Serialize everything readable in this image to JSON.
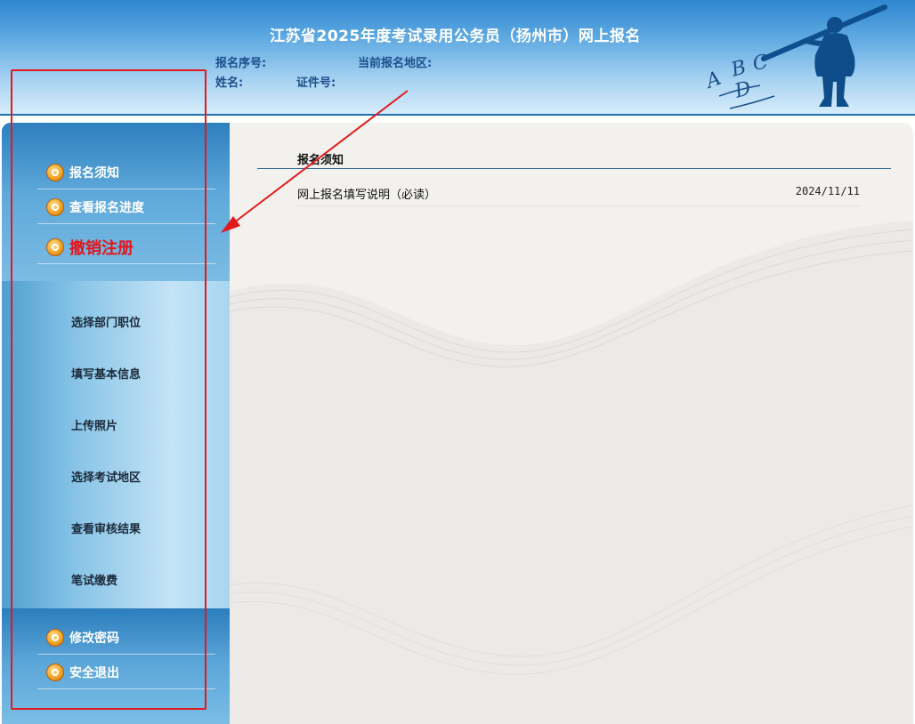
{
  "header": {
    "title": "江苏省2025年度考试录用公务员（扬州市）网上报名",
    "reg_no_label": "报名序号:",
    "region_label": "当前报名地区:",
    "name_label": "姓名:",
    "id_label": "证件号:",
    "logo_letters": [
      "A",
      "B",
      "C",
      "D"
    ]
  },
  "sidebar": {
    "top_items": [
      {
        "label": "报名须知",
        "icon": "pencil-icon"
      },
      {
        "label": "查看报名进度",
        "icon": "progress-icon"
      },
      {
        "label": "撤销注册",
        "icon": "power-icon"
      }
    ],
    "steps": [
      "选择部门职位",
      "填写基本信息",
      "上传照片",
      "选择考试地区",
      "查看审核结果",
      "笔试缴费"
    ],
    "bottom_items": [
      {
        "label": "修改密码",
        "icon": "key-icon"
      },
      {
        "label": "安全退出",
        "icon": "power-icon"
      }
    ]
  },
  "main": {
    "section_title": "报名须知",
    "notices": [
      {
        "title": "网上报名填写说明（必读）",
        "date": "2024/11/11"
      }
    ]
  },
  "colors": {
    "header_blue": "#2f86cf",
    "highlight_red": "#e3141b",
    "annotation_red": "#e21a1a"
  }
}
